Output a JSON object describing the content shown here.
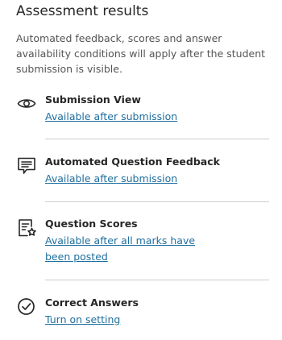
{
  "section": {
    "heading": "Assessment results",
    "intro": "Automated feedback, scores and answer availability conditions will apply after the student submission is visible."
  },
  "settings": [
    {
      "icon": "eye-icon",
      "title": "Submission View",
      "link": "Available after submission"
    },
    {
      "icon": "feedback-message-icon",
      "title": "Automated Question Feedback",
      "link": "Available after submission"
    },
    {
      "icon": "scores-document-star-icon",
      "title": "Question Scores",
      "link": "Available after all marks have been posted"
    },
    {
      "icon": "check-circle-icon",
      "title": "Correct Answers",
      "link": "Turn on setting"
    }
  ],
  "colors": {
    "text": "#262626",
    "muted": "#545454",
    "link": "#1f6e9e",
    "divider": "#cdcdcd"
  }
}
